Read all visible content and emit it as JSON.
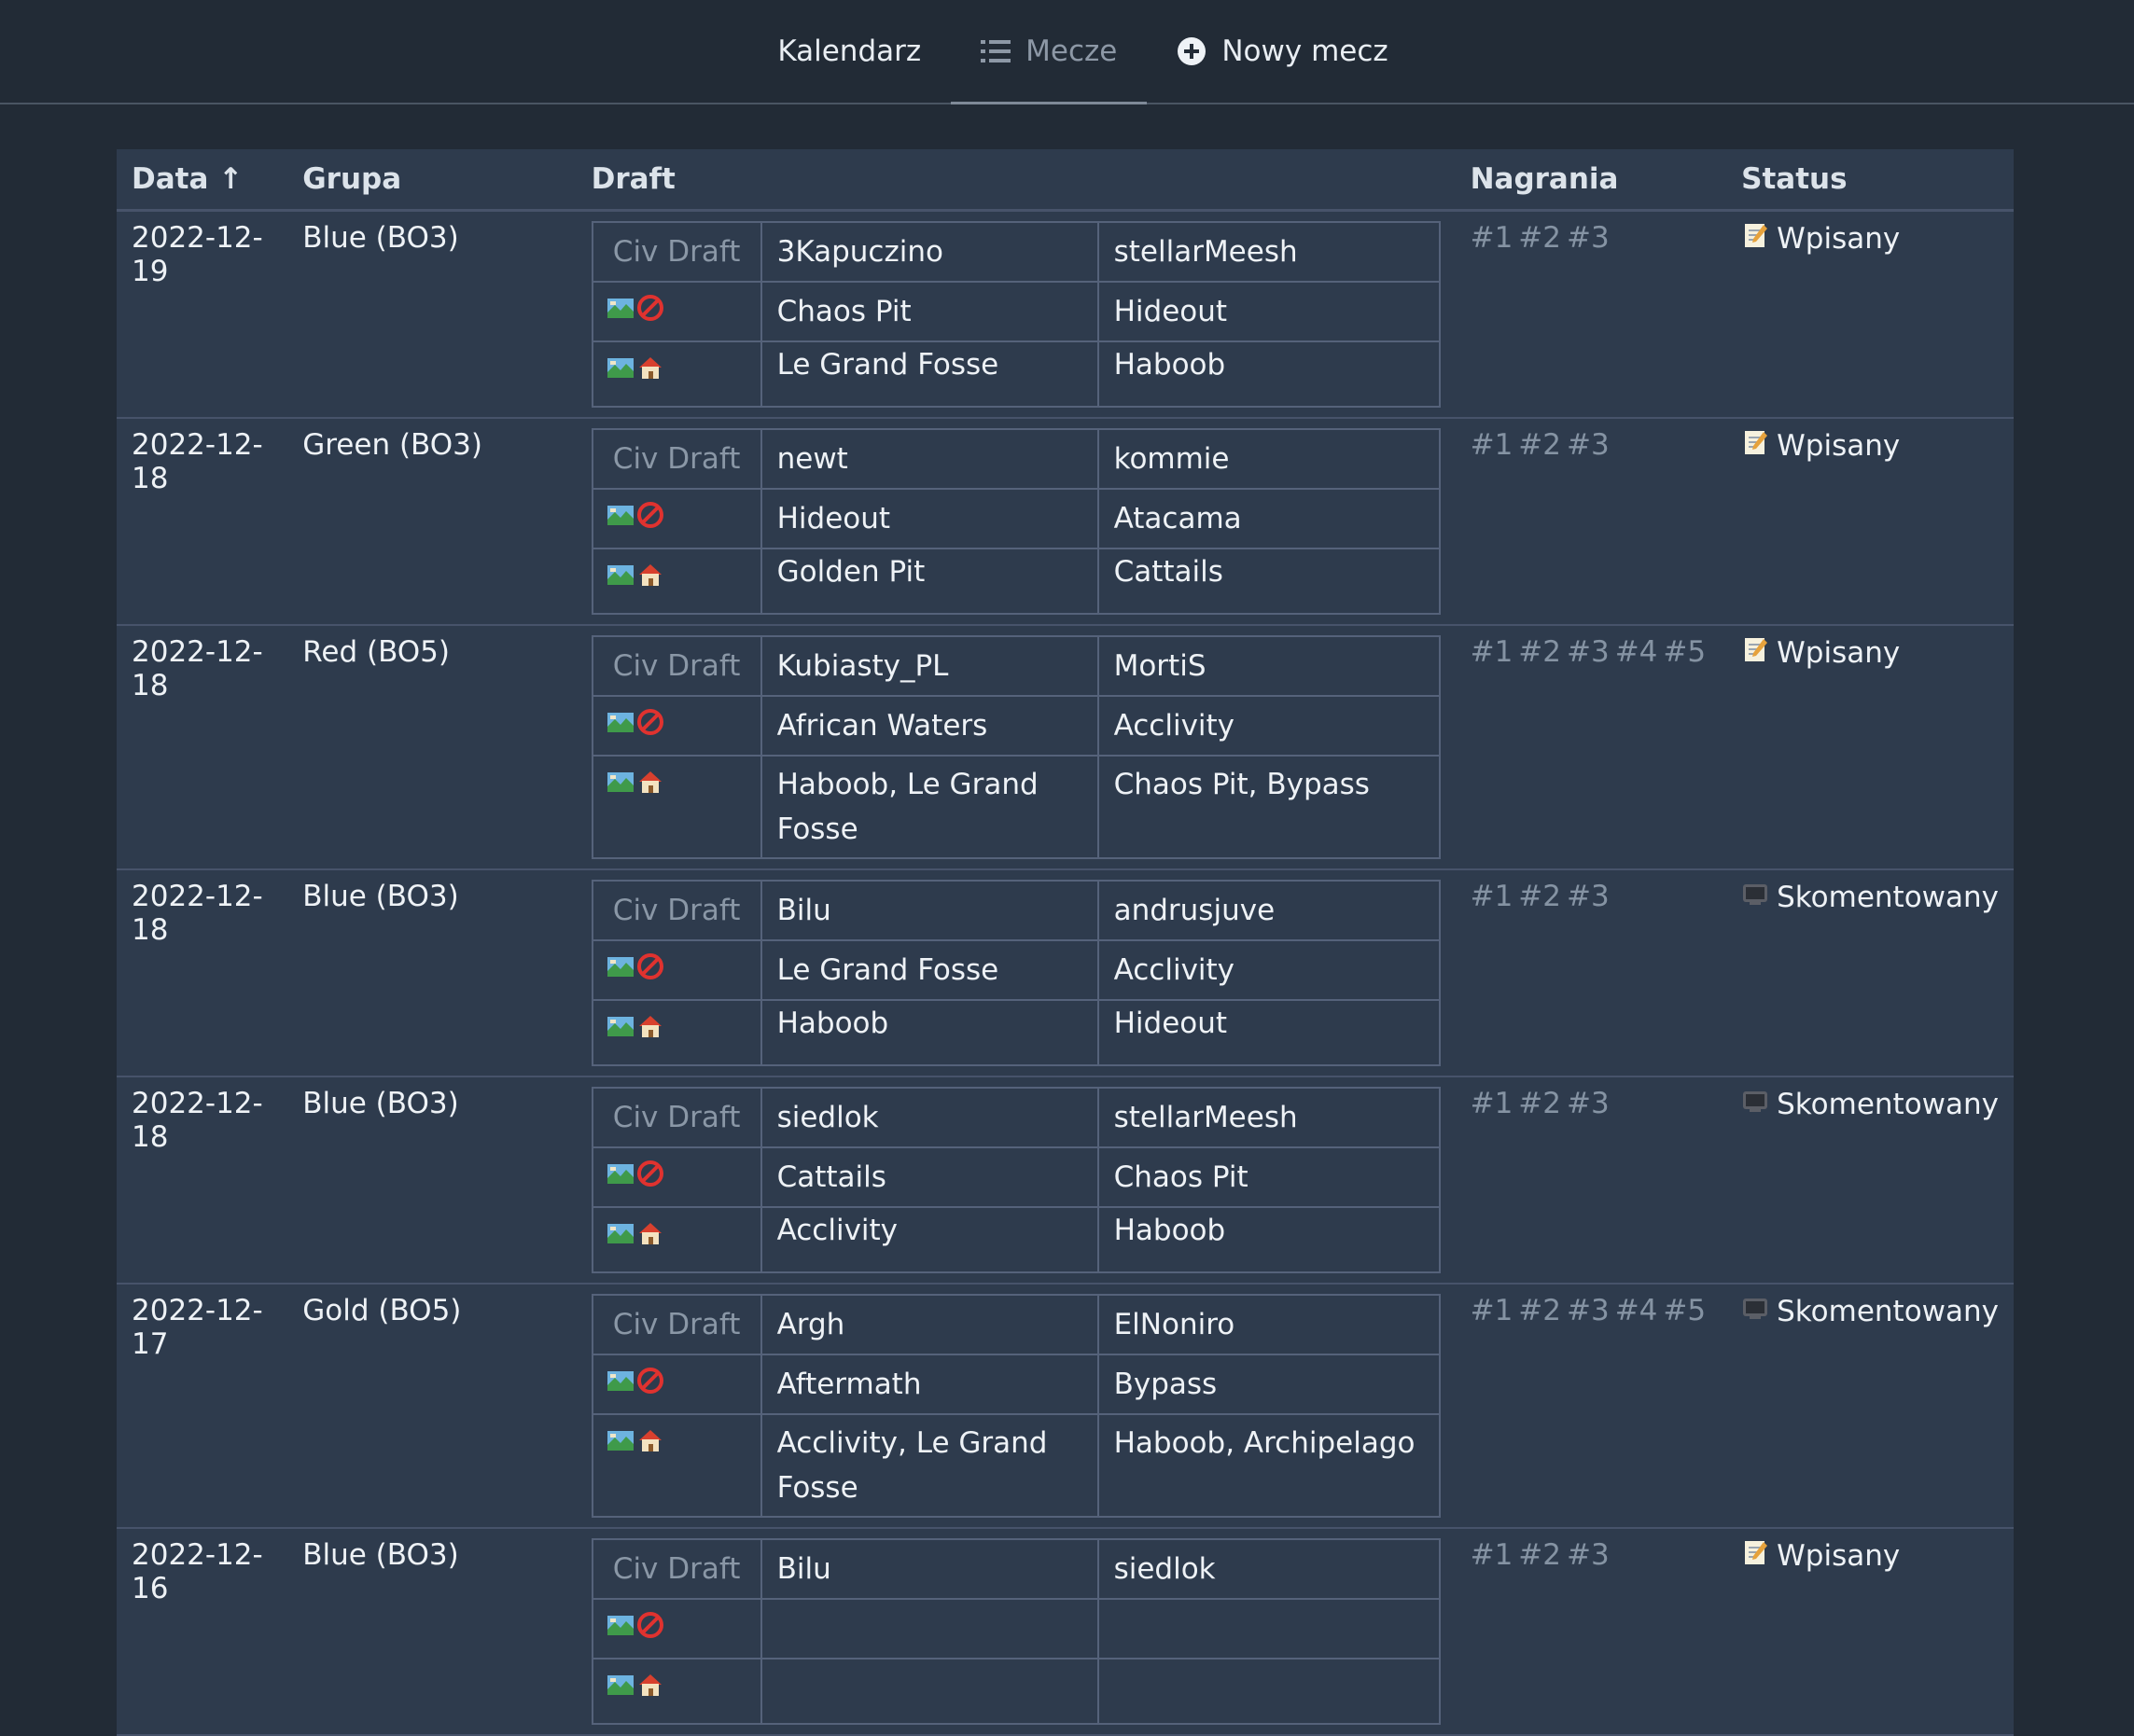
{
  "nav": {
    "tabs": [
      {
        "label": "Kalendarz",
        "icon": ""
      },
      {
        "label": "Mecze",
        "icon": "list-icon"
      },
      {
        "label": "Nowy mecz",
        "icon": "plus-circle-icon"
      }
    ],
    "active": "Mecze"
  },
  "table": {
    "headers": {
      "date": "Data ↑",
      "group": "Grupa",
      "draft": "Draft",
      "recordings": "Nagrania",
      "status": "Status"
    },
    "civ_label": "Civ Draft",
    "rows": [
      {
        "date": "2022-12-19",
        "group": "Blue (BO3)",
        "p1": "3Kapuczino",
        "p2": "stellarMeesh",
        "ban1": "Chaos Pit",
        "ban2": "Hideout",
        "home1": "Le Grand Fosse",
        "home2": "Haboob",
        "recordings": [
          "#1",
          "#2",
          "#3"
        ],
        "status": "Wpisany",
        "status_icon": "memo-icon"
      },
      {
        "date": "2022-12-18",
        "group": "Green (BO3)",
        "p1": "newt",
        "p2": "kommie",
        "ban1": "Hideout",
        "ban2": "Atacama",
        "home1": "Golden Pit",
        "home2": "Cattails",
        "recordings": [
          "#1",
          "#2",
          "#3"
        ],
        "status": "Wpisany",
        "status_icon": "memo-icon"
      },
      {
        "date": "2022-12-18",
        "group": "Red (BO5)",
        "p1": "Kubiasty_PL",
        "p2": "MortiS",
        "ban1": "African Waters",
        "ban2": "Acclivity",
        "home1": "Haboob, Le Grand Fosse",
        "home2": "Chaos Pit, Bypass",
        "recordings": [
          "#1",
          "#2",
          "#3",
          "#4",
          "#5"
        ],
        "status": "Wpisany",
        "status_icon": "memo-icon"
      },
      {
        "date": "2022-12-18",
        "group": "Blue (BO3)",
        "p1": "Bilu",
        "p2": "andrusjuve",
        "ban1": "Le Grand Fosse",
        "ban2": "Acclivity",
        "home1": "Haboob",
        "home2": "Hideout",
        "recordings": [
          "#1",
          "#2",
          "#3"
        ],
        "status": "Skomentowany",
        "status_icon": "tv-icon"
      },
      {
        "date": "2022-12-18",
        "group": "Blue (BO3)",
        "p1": "siedlok",
        "p2": "stellarMeesh",
        "ban1": "Cattails",
        "ban2": "Chaos Pit",
        "home1": "Acclivity",
        "home2": "Haboob",
        "recordings": [
          "#1",
          "#2",
          "#3"
        ],
        "status": "Skomentowany",
        "status_icon": "tv-icon"
      },
      {
        "date": "2022-12-17",
        "group": "Gold (BO5)",
        "p1": "Argh",
        "p2": "ElNoniro",
        "ban1": "Aftermath",
        "ban2": "Bypass",
        "home1": "Acclivity, Le Grand Fosse",
        "home2": "Haboob, Archipelago",
        "recordings": [
          "#1",
          "#2",
          "#3",
          "#4",
          "#5"
        ],
        "status": "Skomentowany",
        "status_icon": "tv-icon"
      },
      {
        "date": "2022-12-16",
        "group": "Blue (BO3)",
        "p1": "Bilu",
        "p2": "siedlok",
        "ban1": "",
        "ban2": "",
        "home1": "",
        "home2": "",
        "recordings": [
          "#1",
          "#2",
          "#3"
        ],
        "status": "Wpisany",
        "status_icon": "memo-icon"
      }
    ]
  }
}
